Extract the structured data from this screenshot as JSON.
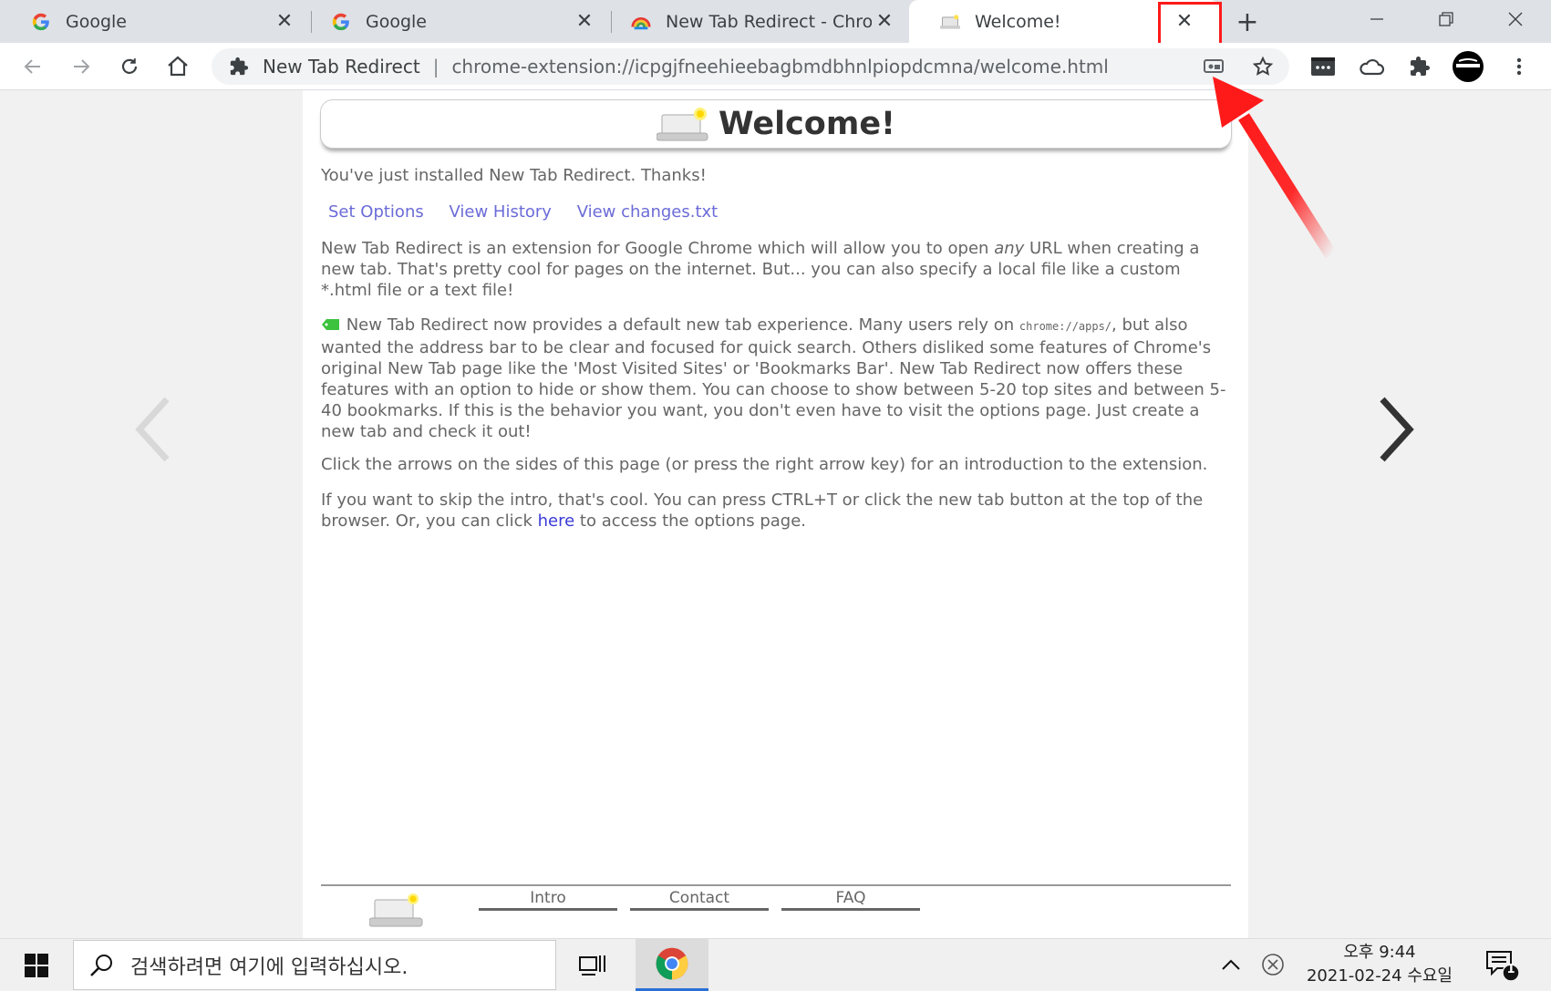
{
  "tabs": [
    {
      "title": "Google",
      "close": "✕"
    },
    {
      "title": "Google",
      "close": "✕"
    },
    {
      "title": "New Tab Redirect - Chrome",
      "close": "✕"
    },
    {
      "title": "Welcome!",
      "close": "✕"
    }
  ],
  "new_tab_label": "+",
  "omnibox": {
    "extension_name": "New Tab Redirect",
    "separator": "|",
    "url": "chrome-extension://icpgjfneehieebagbmdbhnlpiopdcmna/welcome.html"
  },
  "page": {
    "title": "Welcome!",
    "intro": "You've just installed New Tab Redirect. Thanks!",
    "links": [
      "Set Options",
      "View History",
      "View changes.txt"
    ],
    "p1": "New Tab Redirect is an extension for Google Chrome which will allow you to open ",
    "p1_em": "any",
    "p1_rest": " URL when creating a new tab. That's pretty cool for pages on the internet. But... you can also specify a local file like a custom *.html file or a text file!",
    "p2_start": " New Tab Redirect now provides a default new tab experience. Many users rely on ",
    "p2_code": "chrome://apps/",
    "p2_rest": ", but also wanted the address bar to be clear and focused for quick search. Others disliked some features of Chrome's original New Tab page like the 'Most Visited Sites' or 'Bookmarks Bar'. New Tab Redirect now offers these features with an option to hide or show them. You can choose to show between 5-20 top sites and between 5-40 bookmarks. If this is the behavior you want, you don't even have to visit the options page. Just create a new tab and check it out!",
    "p3": "Click the arrows on the sides of this page (or press the right arrow key) for an introduction to the extension.",
    "p4_start": "If you want to skip the intro, that's cool. You can press CTRL+T or click the new tab button at the top of the browser. Or, you can click ",
    "p4_link": "here",
    "p4_rest": " to access the options page.",
    "footer_tabs": [
      "Intro",
      "Contact",
      "FAQ"
    ]
  },
  "taskbar": {
    "search_placeholder": "검색하려면 여기에 입력하십시오.",
    "time": "오후 9:44",
    "date": "2021-02-24 수요일",
    "notification_count": "1"
  },
  "colors": {
    "annotation_red": "#ff1a1a",
    "link_blue": "#6b6bd8",
    "tag_green": "#3cc23c"
  }
}
